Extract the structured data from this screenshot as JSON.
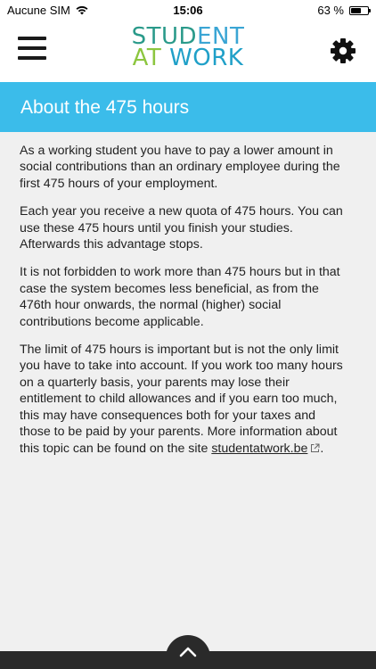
{
  "status_bar": {
    "carrier": "Aucune SIM",
    "time": "15:06",
    "battery_percent": "63 %",
    "battery_level": 0.63
  },
  "header": {
    "logo_line1": [
      "STUD",
      "ENT"
    ],
    "logo_line2": [
      "AT",
      " ",
      "WORK"
    ],
    "menu_icon": "hamburger-icon",
    "settings_icon": "gear-icon"
  },
  "page": {
    "title": "About the 475 hours"
  },
  "content": {
    "paragraphs": [
      "As a working student you have to pay a lower amount in social contributions than an ordinary employee during the first 475 hours of your employment.",
      "Each year you receive a new quota of 475 hours. You can use these 475 hours until you finish your studies. Afterwards this advantage stops.",
      "It is not forbidden to work more than 475 hours but in that case the system becomes less beneficial, as from the 476th hour onwards, the normal (higher) social contributions become applicable."
    ],
    "last_paragraph_text": "The limit of 475 hours is important but is not the only limit you have to take into account. If you work too many hours on a quarterly basis, your parents may lose their entitlement to child allowances and if you earn too much, this may have consequences both for your taxes and those to be paid by your parents. More information about this topic can be found on the site ",
    "link_text": "studentatwork.be",
    "last_paragraph_end": "."
  },
  "colors": {
    "title_bar": "#3bbcea",
    "background": "#f0f0f0",
    "bottom_bar": "#2a2a2a"
  }
}
